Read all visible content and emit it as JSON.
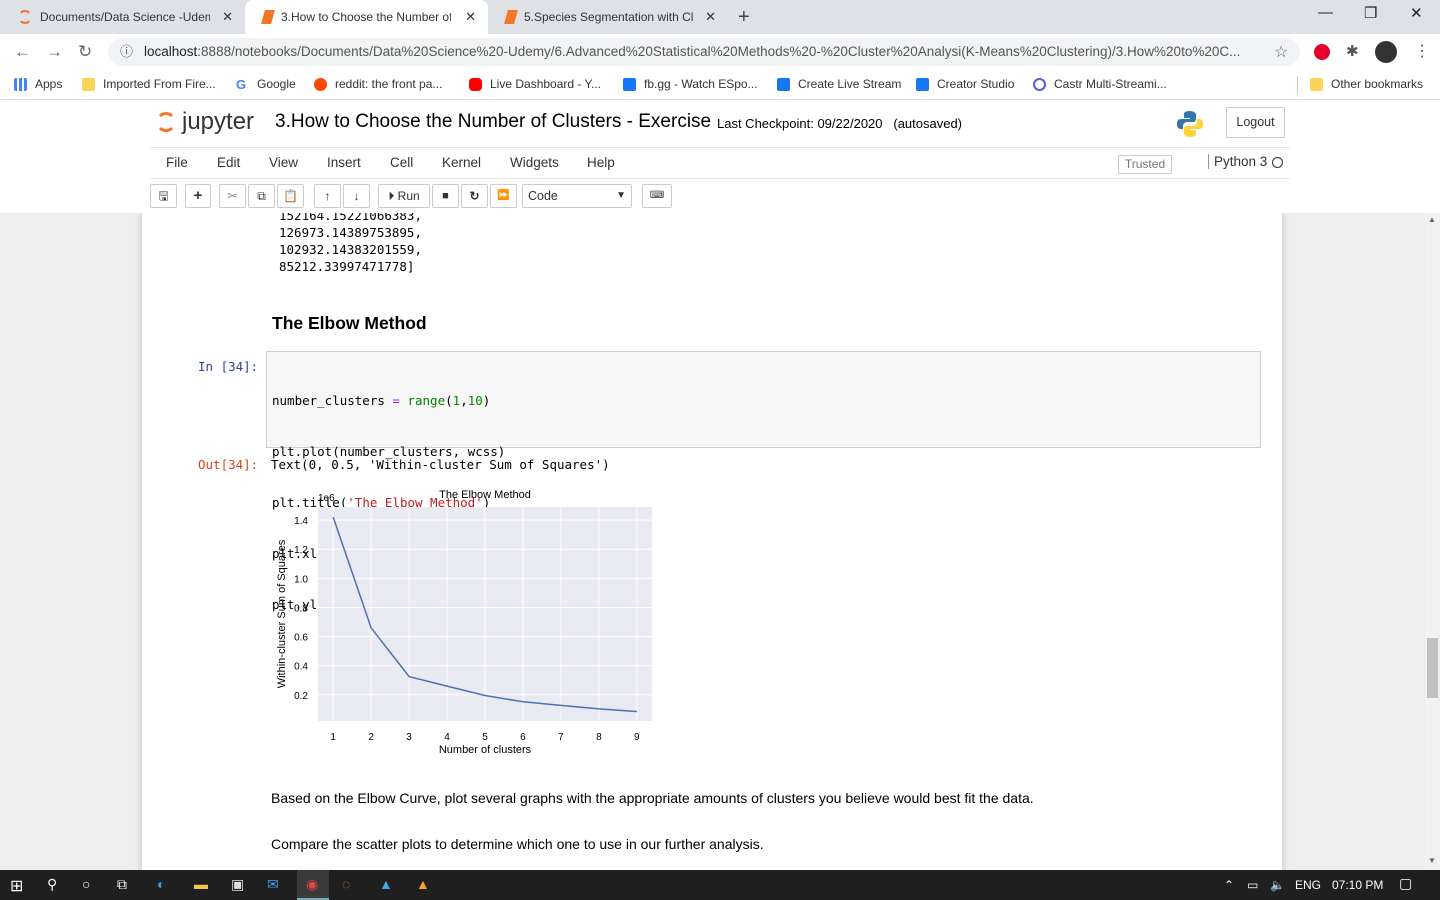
{
  "browser": {
    "tabs": [
      {
        "title": "Documents/Data Science -Udem",
        "active": false
      },
      {
        "title": "3.How to Choose the Number of",
        "active": true
      },
      {
        "title": "5.Species Segmentation with Clu",
        "active": false
      }
    ],
    "url_host": "localhost",
    "url_rest": ":8888/notebooks/Documents/Data%20Science%20-Udemy/6.Advanced%20Statistical%20Methods%20-%20Cluster%20Analysi(K-Means%20Clustering)/3.How%20to%20C...",
    "bookmarks": [
      "Apps",
      "Imported From Fire...",
      "Google",
      "reddit: the front pa...",
      "Live Dashboard - Y...",
      "fb.gg - Watch ESpo...",
      "Create Live Stream",
      "Creator Studio",
      "Castr Multi-Streami..."
    ],
    "other_bookmarks": "Other bookmarks"
  },
  "jupyter": {
    "logo_text": "jupyter",
    "notebook_title": "3.How to Choose the Number of Clusters - Exercise",
    "checkpoint": "Last Checkpoint: 09/22/2020",
    "autosave": "(autosaved)",
    "logout": "Logout",
    "menus": [
      "File",
      "Edit",
      "View",
      "Insert",
      "Cell",
      "Kernel",
      "Widgets",
      "Help"
    ],
    "trusted": "Trusted",
    "kernel": "Python 3",
    "run_label": "Run",
    "cell_type": "Code"
  },
  "notebook": {
    "prev_output_lines": [
      "152164.15221066383,",
      "126973.14389753895,",
      "102932.14383201559,",
      "85212.33997471778]"
    ],
    "heading": "The Elbow Method",
    "in_prompt": "In [34]:",
    "code_lines": [
      "number_clusters = range(1,10)",
      "plt.plot(number_clusters, wcss)",
      "plt.title('The Elbow Method')",
      "plt.xlabel('Number of clusters')",
      "plt.ylabel('Within-cluster Sum of Squares')"
    ],
    "out_prompt": "Out[34]:",
    "out_text": "Text(0, 0.5, 'Within-cluster Sum of Squares')",
    "md1": "Based on the Elbow Curve, plot several graphs with the appropriate amounts of clusters you believe would best fit the data.",
    "md2": "Compare the scatter plots to determine which one to use in our further analysis."
  },
  "chart_data": {
    "type": "line",
    "title": "The Elbow Method",
    "xlabel": "Number of clusters",
    "ylabel": "Within-cluster Sum of Squares",
    "offset_text": "1e6",
    "x": [
      1,
      2,
      3,
      4,
      5,
      6,
      7,
      8,
      9
    ],
    "y": [
      1.42,
      0.66,
      0.325,
      0.26,
      0.195,
      0.152,
      0.127,
      0.103,
      0.085
    ],
    "xticks": [
      1,
      2,
      3,
      4,
      5,
      6,
      7,
      8,
      9
    ],
    "yticks": [
      0.2,
      0.4,
      0.6,
      0.8,
      1.0,
      1.2,
      1.4
    ],
    "ytick_labels": [
      "0.2",
      "0.4",
      "0.6",
      "0.8",
      "1.0",
      "1.2",
      "1.4"
    ],
    "xlim": [
      0.6,
      9.4
    ],
    "ylim": [
      0.02,
      1.49
    ],
    "line_color": "#4c72b0",
    "background": "#eaeaf2",
    "grid": true
  },
  "taskbar": {
    "lang": "ENG",
    "time": "07:10 PM"
  }
}
